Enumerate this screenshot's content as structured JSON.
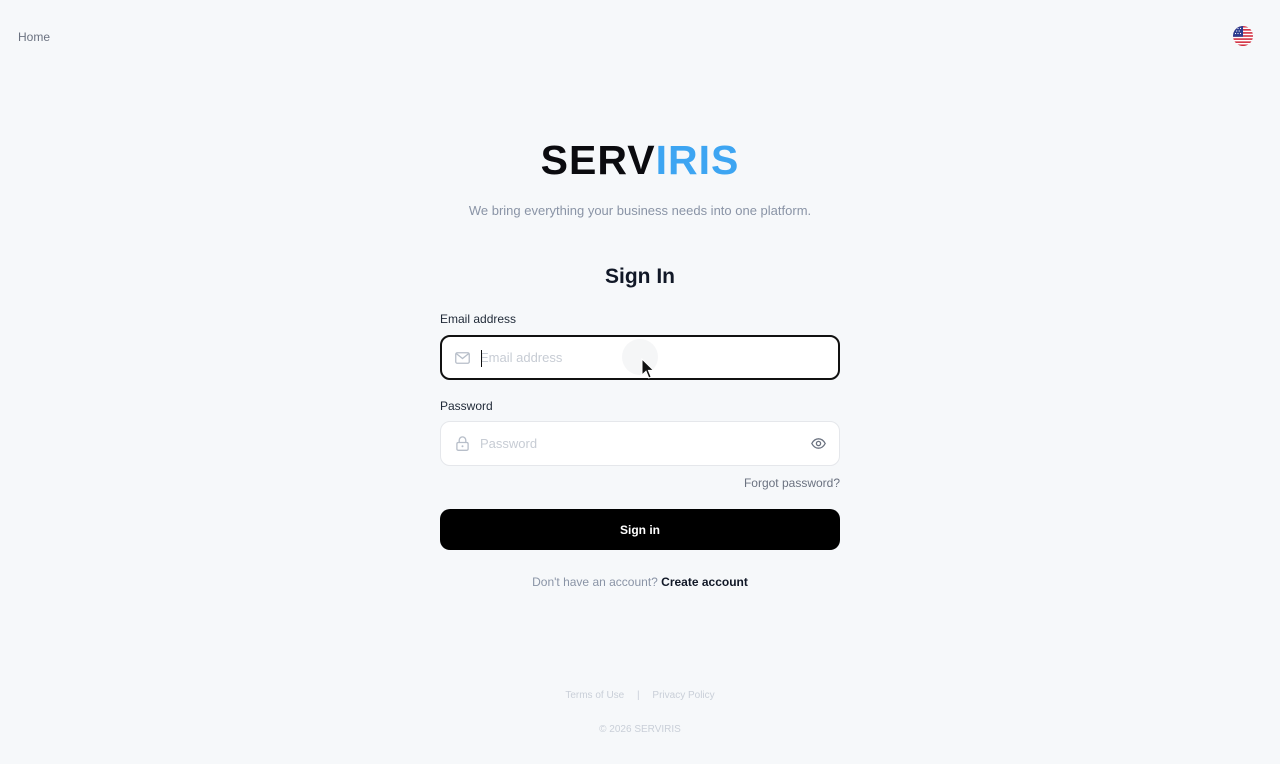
{
  "nav": {
    "home_label": "Home"
  },
  "language": {
    "icon": "us-flag-icon"
  },
  "brand": {
    "part1": "SERV",
    "part2": "IRIS",
    "accent_color": "#3da5f2"
  },
  "tagline": "We bring everything your business needs into one platform.",
  "form": {
    "title": "Sign In",
    "email_label": "Email address",
    "email_placeholder": "Email address",
    "email_value": "",
    "password_label": "Password",
    "password_placeholder": "Password",
    "password_value": "",
    "forgot_label": "Forgot password?",
    "submit_label": "Sign in"
  },
  "signup": {
    "prompt": "Don't have an account?",
    "link_label": "Create account"
  },
  "footer": {
    "terms_label": "Terms of Use",
    "separator": "|",
    "privacy_label": "Privacy Policy",
    "copyright": "© 2026 SERVIRIS"
  },
  "icons": {
    "email": "mail-icon",
    "password": "lock-icon",
    "toggle": "eye-icon"
  }
}
